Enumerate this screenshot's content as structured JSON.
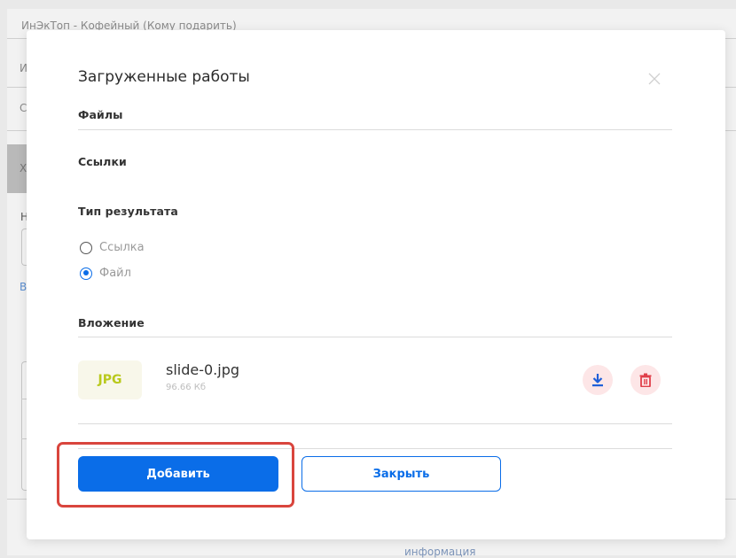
{
  "background": {
    "row1_text": "ИнЭкТоп - Кофейный (Кому подарить)",
    "row2_text": "И",
    "row3_text": "С",
    "dark_text": "Х",
    "label_text": "Н",
    "link_text": "В",
    "bottom_text": "информация"
  },
  "modal": {
    "title": "Загруженные работы",
    "sections": {
      "files_label": "Файлы",
      "links_label": "Ссылки",
      "result_type_label": "Тип результата",
      "attachment_label": "Вложение"
    },
    "radio_options": [
      {
        "label": "Ссылка",
        "checked": false
      },
      {
        "label": "Файл",
        "checked": true
      }
    ],
    "attachment": {
      "type_badge": "JPG",
      "file_name": "slide-0.jpg",
      "file_size": "96.66 Кб",
      "download_icon": "download-icon",
      "delete_icon": "trash-icon"
    },
    "buttons": {
      "add_label": "Добавить",
      "close_label": "Закрыть"
    }
  },
  "colors": {
    "primary": "#0a6de8",
    "highlight": "#d9453d",
    "badge_text": "#b9c91c",
    "icon_bg": "#fde6e7",
    "icon_color": "#e0404a"
  }
}
